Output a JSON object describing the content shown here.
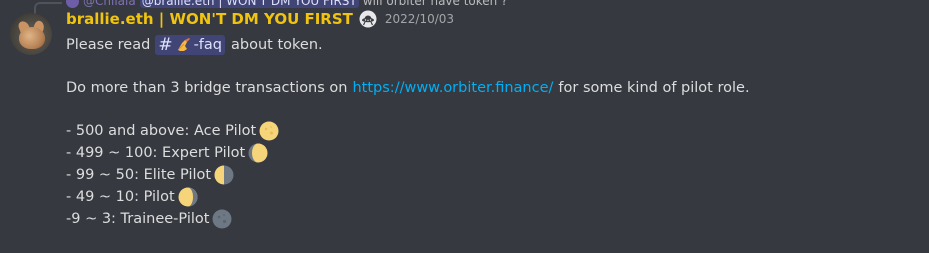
{
  "reply": {
    "author": "@Chilala",
    "mention": "@brallie.eth | WON'T DM YOU FIRST",
    "text": "will orbiter have token ?"
  },
  "message": {
    "username": "brallie.eth | WON'T DM YOU FIRST",
    "badge_icon": "ufo-icon",
    "timestamp": "2022/10/03",
    "line1_prefix": "Please read",
    "channel": {
      "hash": "#",
      "icon": "writing-hand-icon",
      "name": "-faq"
    },
    "line1_suffix": "about token.",
    "line2_prefix": "Do more than 3 bridge transactions on",
    "link": "https://www.orbiter.finance/",
    "line2_suffix": "for some kind of pilot role.",
    "tiers": [
      {
        "label": "- 500 and above: Ace Pilot",
        "icon": "full-moon-icon"
      },
      {
        "label": "- 499 ~ 100: Expert Pilot",
        "icon": "waxing-gibbous-moon-icon"
      },
      {
        "label": "- 99 ~ 50: Elite Pilot",
        "icon": "first-quarter-moon-icon"
      },
      {
        "label": "- 49 ~ 10: Pilot",
        "icon": "waxing-crescent-moon-icon"
      },
      {
        "label": "-9 ~ 3: Trainee-Pilot",
        "icon": "new-moon-icon"
      }
    ]
  },
  "colors": {
    "background": "#36393f",
    "username": "#f1c40f",
    "link": "#00aff4",
    "mention_bg": "#414675",
    "moon_light": "#f5d47a",
    "moon_dark": "#6d7884"
  }
}
